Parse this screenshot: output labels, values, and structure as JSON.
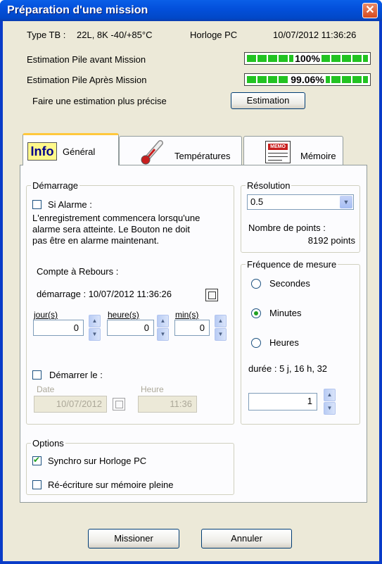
{
  "window": {
    "title": "Préparation d'une mission"
  },
  "info": {
    "type_label": "Type TB :",
    "type_value": "22L, 8K -40/+85°C",
    "clock_label": "Horloge PC",
    "clock_value": "10/07/2012 11:36:26",
    "battery_before_label": "Estimation Pile avant Mission",
    "battery_before_pct": "100%",
    "battery_before_fill": 1.0,
    "battery_after_label": "Estimation Pile Après Mission",
    "battery_after_pct": "99.06%",
    "battery_after_fill": 0.9906,
    "estimate_label": "Faire une estimation plus précise",
    "estimate_button": "Estimation"
  },
  "tabs": [
    {
      "label": "Général",
      "icon": "info-icon",
      "icon_text": "Info",
      "active": true
    },
    {
      "label": "Températures",
      "icon": "thermometer-icon",
      "active": false
    },
    {
      "label": "Mémoire",
      "icon": "memo-icon",
      "icon_text": "MEMO",
      "active": false
    }
  ],
  "demarrage": {
    "legend": "Démarrage",
    "alarm_label": "Si Alarme :",
    "alarm_checked": false,
    "alarm_text_1": "L'enregistrement commencera lorsqu'une",
    "alarm_text_2": "alarme sera atteinte. Le Bouton ne doit",
    "alarm_text_3": "pas être en alarme maintenant.",
    "countdown_label": "Compte à Rebours :",
    "start_text": "démarrage : 10/07/2012 11:36:26",
    "days_label": "jour(s)",
    "days_value": "0",
    "hours_label": "heure(s)",
    "hours_value": "0",
    "mins_label": "min(s)",
    "mins_value": "0",
    "start_on_label": "Démarrer le :",
    "start_on_checked": false,
    "date_label": "Date",
    "date_value": "10/07/2012",
    "time_label": "Heure",
    "time_value": "11:36"
  },
  "resolution": {
    "legend": "Résolution",
    "selected": "0.5",
    "points_label": "Nombre de points :",
    "points_value": "8192 points"
  },
  "frequency": {
    "legend": "Fréquence de mesure",
    "options": [
      "Secondes",
      "Minutes",
      "Heures"
    ],
    "selected": "Minutes",
    "duration": "durée : 5 j, 16 h, 32",
    "value": "1"
  },
  "options": {
    "legend": "Options",
    "sync_label": "Synchro sur Horloge PC",
    "sync_checked": true,
    "rewrite_label": "Ré-écriture sur mémoire pleine",
    "rewrite_checked": false
  },
  "buttons": {
    "mission": "Missioner",
    "cancel": "Annuler"
  },
  "colors": {
    "title_bar": "#0350DC",
    "battery_fill": "#22C322",
    "tab_highlight": "#FFC83C",
    "close_button": "#D64A1E"
  }
}
